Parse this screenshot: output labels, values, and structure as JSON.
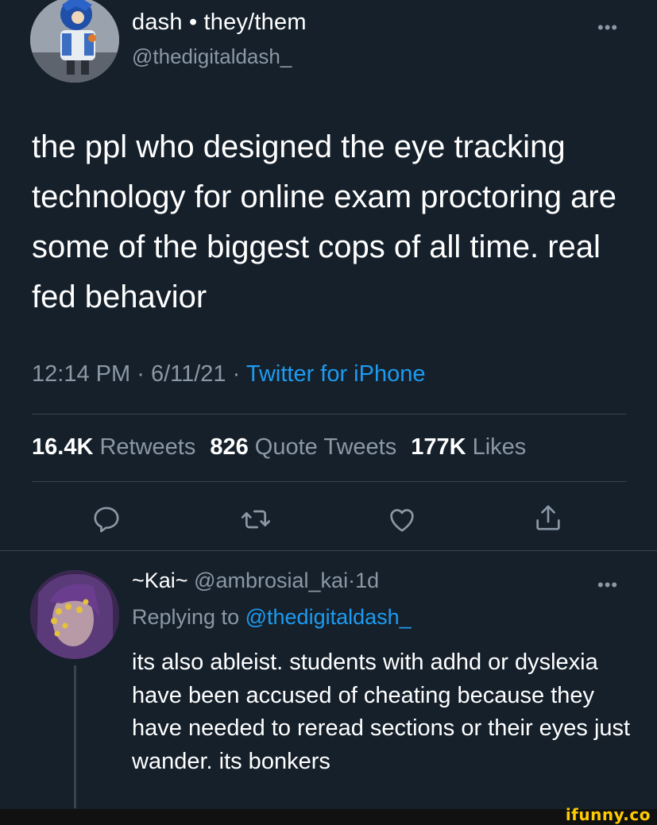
{
  "tweet": {
    "author": {
      "display_name": "dash • they/them",
      "handle": "@thedigitaldash_"
    },
    "more_label": "•••",
    "text": "the ppl who designed the eye tracking technology for online exam proctoring are some of the biggest cops of all time. real fed behavior",
    "time": "12:14 PM",
    "date": "6/11/21",
    "meta_separator": "·",
    "source": "Twitter for iPhone",
    "stats": {
      "retweets_count": "16.4K",
      "retweets_label": "Retweets",
      "quotes_count": "826",
      "quotes_label": "Quote Tweets",
      "likes_count": "177K",
      "likes_label": "Likes"
    },
    "actions": [
      "reply-icon",
      "retweet-icon",
      "like-icon",
      "share-icon"
    ]
  },
  "reply": {
    "author": {
      "display_name": "~Kai~",
      "handle": "@ambrosial_kai",
      "separator": "·",
      "age": "1d"
    },
    "more_label": "•••",
    "replying_prefix": "Replying to",
    "replying_to": "@thedigitaldash_",
    "text": "its also ableist. students with adhd or dyslexia have been accused of cheating because they have needed to reread sections or their eyes just wander. its bonkers"
  },
  "watermark": "ifunny.co",
  "colors": {
    "background": "#15202b",
    "primary_text": "#ffffff",
    "secondary_text": "#8b98a5",
    "accent": "#1d9bf0",
    "divider": "#38444d",
    "watermark": "#ffcc00"
  }
}
